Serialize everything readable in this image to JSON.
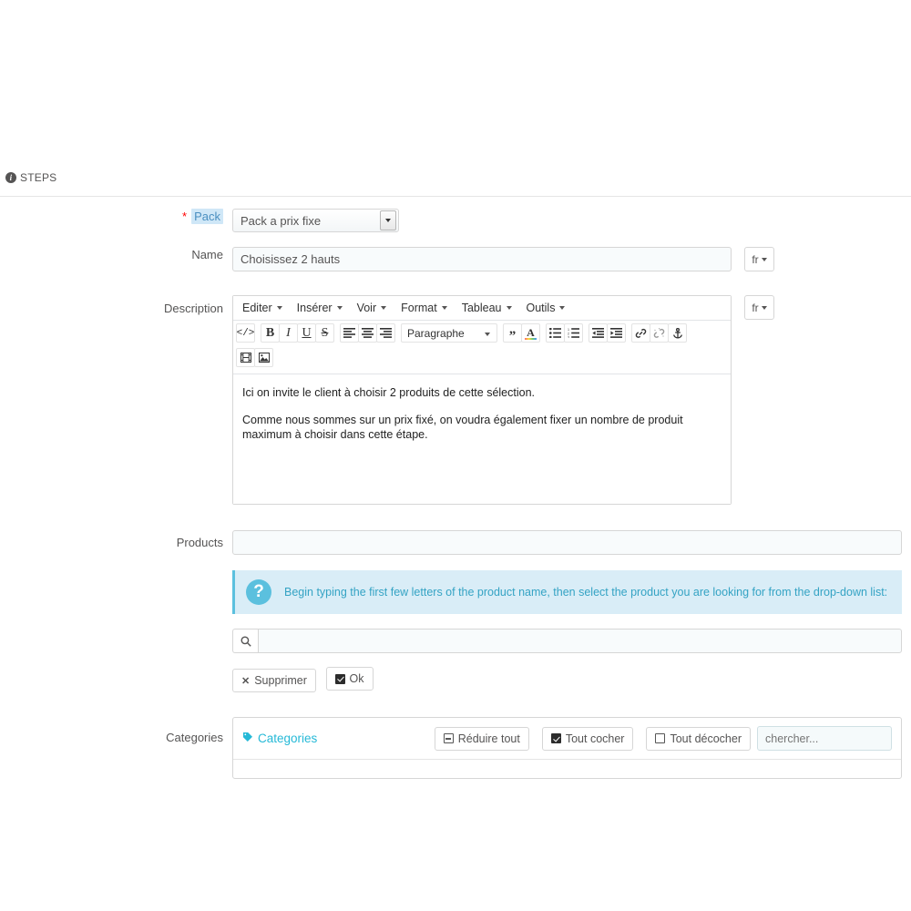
{
  "panel": {
    "heading": "STEPS",
    "info_icon": "info-circle-icon"
  },
  "form": {
    "pack": {
      "label": "Pack",
      "required_marker": "*",
      "selected": "Pack a prix fixe",
      "options": [
        "Pack a prix fixe"
      ]
    },
    "name": {
      "label": "Name",
      "value": "Choisissez 2 hauts",
      "lang": "fr"
    },
    "description": {
      "label": "Description",
      "lang": "fr",
      "menubar": [
        {
          "label": "Editer"
        },
        {
          "label": "Insérer"
        },
        {
          "label": "Voir"
        },
        {
          "label": "Format"
        },
        {
          "label": "Tableau"
        },
        {
          "label": "Outils"
        }
      ],
      "format_select": "Paragraphe",
      "toolbar_icons": [
        "source-code-icon",
        "bold-icon",
        "italic-icon",
        "underline-icon",
        "strikethrough-icon",
        "align-left-icon",
        "align-center-icon",
        "align-right-icon",
        "blockquote-icon",
        "text-color-icon",
        "bullet-list-icon",
        "numbered-list-icon",
        "outdent-icon",
        "indent-icon",
        "link-icon",
        "unlink-icon",
        "anchor-icon",
        "video-icon",
        "image-icon"
      ],
      "body_paragraphs": [
        "Ici on invite le client à choisir 2 produits de cette sélection.",
        "Comme nous sommes sur un prix fixé, on voudra également fixer un nombre de produit maximum à choisir dans cette étape."
      ]
    },
    "products": {
      "label": "Products",
      "value": "",
      "placeholder": ""
    },
    "alert": {
      "icon": "question-mark-icon",
      "text": "Begin typing the first few letters of the product name, then select the product you are looking for from the drop-down list:"
    },
    "product_search": {
      "icon": "search-icon",
      "value": "",
      "placeholder": ""
    },
    "actions": {
      "delete_label": "Supprimer",
      "delete_icon": "times-icon",
      "ok_label": "Ok",
      "ok_icon": "check-square-icon"
    },
    "categories": {
      "label": "Categories",
      "panel_title": "Categories",
      "title_icon": "tag-icon",
      "collapse_all": "Réduire tout",
      "check_all": "Tout cocher",
      "uncheck_all": "Tout décocher",
      "search_placeholder": "chercher...",
      "search_value": ""
    }
  },
  "colors": {
    "accent": "#25b9d7",
    "info_bg": "#d9edf7",
    "info_border": "#5bc0de",
    "required": "#ff0000",
    "label_highlight": "#cfe7f7",
    "text": "#555454"
  }
}
